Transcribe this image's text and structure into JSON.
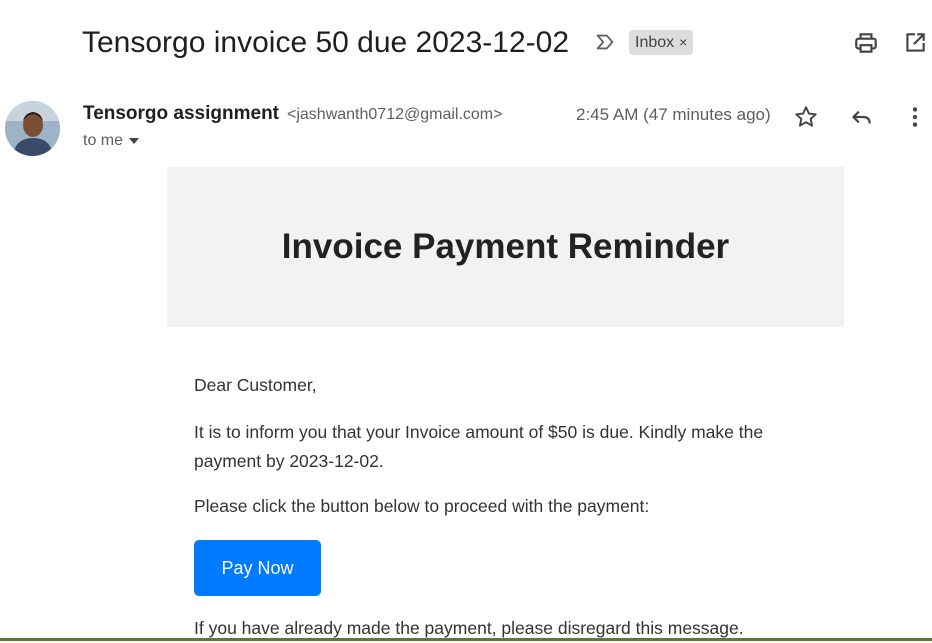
{
  "email": {
    "subject": "Tensorgo invoice 50 due 2023-12-02",
    "label_chip": "Inbox",
    "label_chip_remove": "×",
    "sender_name": "Tensorgo assignment",
    "sender_email": "<jashwanth0712@gmail.com>",
    "time": "2:45 AM (47 minutes ago)",
    "recipient": "to me"
  },
  "body": {
    "heading": "Invoice Payment Reminder",
    "greeting": "Dear Customer,",
    "paragraph1": "It is to inform you that your Invoice amount of $50 is due. Kindly make the payment by 2023-12-02.",
    "paragraph2": "Please click the button below to proceed with the payment:",
    "button_label": "Pay Now",
    "paragraph3": "If you have already made the payment, please disregard this message."
  },
  "colors": {
    "button": "#007bff",
    "header_bg": "#f2f2f2"
  },
  "icons": [
    "label-importance-icon",
    "print-icon",
    "open-in-new-window-icon",
    "star-icon",
    "reply-icon",
    "more-vert-icon",
    "caret-down-icon"
  ]
}
